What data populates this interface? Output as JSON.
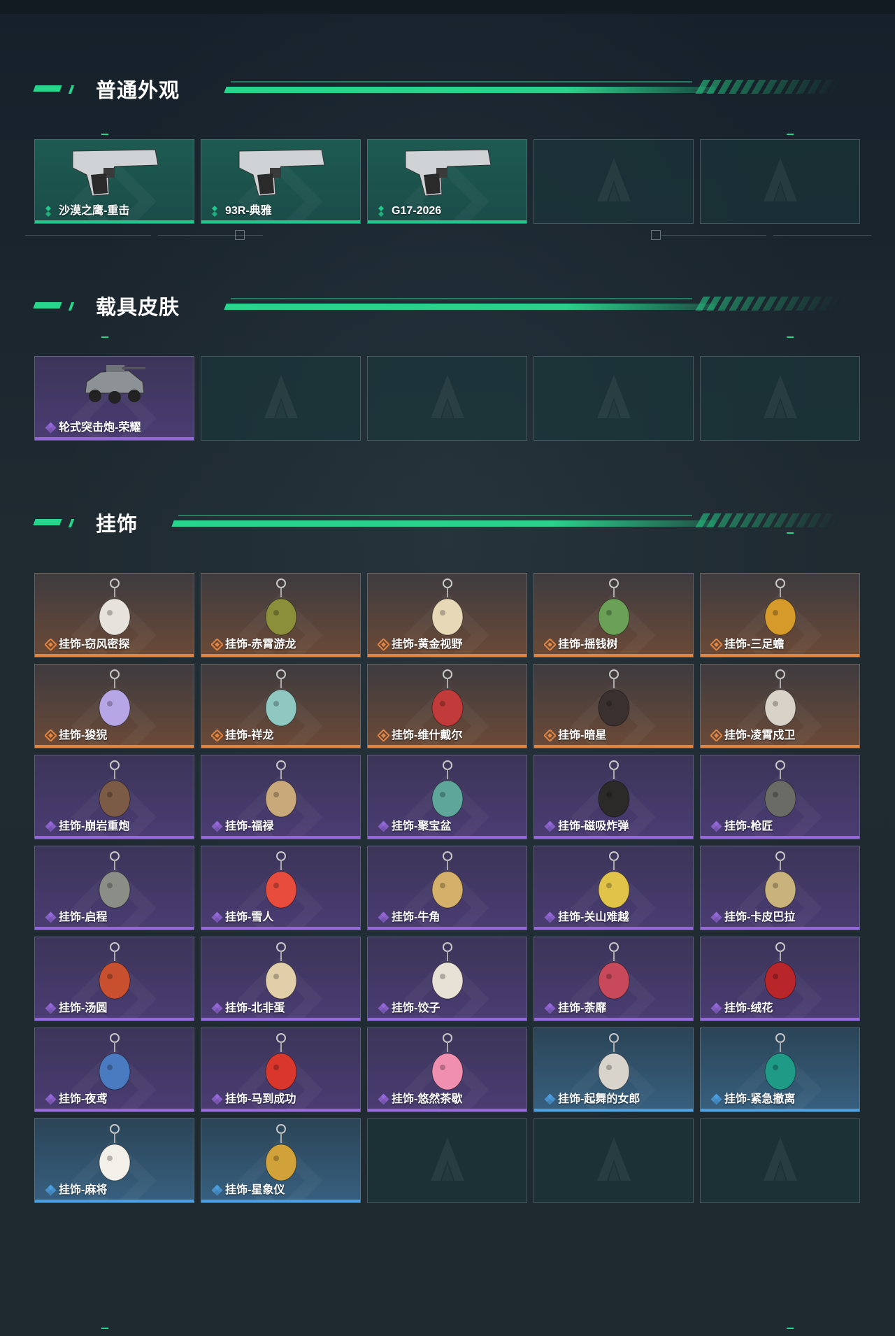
{
  "colors": {
    "accent": "#27d58b",
    "green_rarity": "#22c78a",
    "purple_rarity": "#9468d8",
    "orange_rarity": "#e08645",
    "blue_rarity": "#4b9fe0"
  },
  "sections": {
    "normal": {
      "title": "普通外观",
      "items": [
        {
          "name": "沙漠之鹰-重击",
          "rarity": "green",
          "icon": "pistol-icon"
        },
        {
          "name": "93R-典雅",
          "rarity": "green",
          "icon": "pistol-icon"
        },
        {
          "name": "G17-2026",
          "rarity": "green",
          "icon": "pistol-icon"
        }
      ]
    },
    "vehicle": {
      "title": "载具皮肤",
      "items": [
        {
          "name": "轮式突击炮-荣耀",
          "rarity": "purple",
          "icon": "armored-vehicle-icon"
        }
      ]
    },
    "charms": {
      "title": "挂饰",
      "items": [
        {
          "name": "挂饰-窃风密探",
          "rarity": "orange",
          "icon": "charm-icon"
        },
        {
          "name": "挂饰-赤霄游龙",
          "rarity": "orange",
          "icon": "charm-icon"
        },
        {
          "name": "挂饰-黄金视野",
          "rarity": "orange",
          "icon": "charm-icon"
        },
        {
          "name": "挂饰-摇钱树",
          "rarity": "orange",
          "icon": "charm-icon"
        },
        {
          "name": "挂饰-三足蟾",
          "rarity": "orange",
          "icon": "charm-icon"
        },
        {
          "name": "挂饰-狻猊",
          "rarity": "orange",
          "icon": "charm-icon"
        },
        {
          "name": "挂饰-祥龙",
          "rarity": "orange",
          "icon": "charm-icon"
        },
        {
          "name": "挂饰-维什戴尔",
          "rarity": "orange",
          "icon": "charm-icon"
        },
        {
          "name": "挂饰-暗星",
          "rarity": "orange",
          "icon": "charm-icon"
        },
        {
          "name": "挂饰-凌霄戍卫",
          "rarity": "orange",
          "icon": "charm-icon"
        },
        {
          "name": "挂饰-崩岩重炮",
          "rarity": "purple",
          "icon": "charm-icon"
        },
        {
          "name": "挂饰-福禄",
          "rarity": "purple",
          "icon": "charm-icon"
        },
        {
          "name": "挂饰-聚宝盆",
          "rarity": "purple",
          "icon": "charm-icon"
        },
        {
          "name": "挂饰-磁吸炸弹",
          "rarity": "purple",
          "icon": "charm-icon"
        },
        {
          "name": "挂饰-枪匠",
          "rarity": "purple",
          "icon": "charm-icon"
        },
        {
          "name": "挂饰-启程",
          "rarity": "purple",
          "icon": "charm-icon"
        },
        {
          "name": "挂饰-雪人",
          "rarity": "purple",
          "icon": "charm-icon"
        },
        {
          "name": "挂饰-牛角",
          "rarity": "purple",
          "icon": "charm-icon"
        },
        {
          "name": "挂饰-关山难越",
          "rarity": "purple",
          "icon": "charm-icon"
        },
        {
          "name": "挂饰-卡皮巴拉",
          "rarity": "purple",
          "icon": "charm-icon"
        },
        {
          "name": "挂饰-汤圆",
          "rarity": "purple",
          "icon": "charm-icon"
        },
        {
          "name": "挂饰-北非蛋",
          "rarity": "purple",
          "icon": "charm-icon"
        },
        {
          "name": "挂饰-饺子",
          "rarity": "purple",
          "icon": "charm-icon"
        },
        {
          "name": "挂饰-荼靡",
          "rarity": "purple",
          "icon": "charm-icon"
        },
        {
          "name": "挂饰-绒花",
          "rarity": "purple",
          "icon": "charm-icon"
        },
        {
          "name": "挂饰-夜鸢",
          "rarity": "purple",
          "icon": "charm-icon"
        },
        {
          "name": "挂饰-马到成功",
          "rarity": "purple",
          "icon": "charm-icon"
        },
        {
          "name": "挂饰-悠然茶歇",
          "rarity": "purple",
          "icon": "charm-icon"
        },
        {
          "name": "挂饰-起舞的女郎",
          "rarity": "blue",
          "icon": "charm-icon"
        },
        {
          "name": "挂饰-紧急撤离",
          "rarity": "blue",
          "icon": "charm-icon"
        },
        {
          "name": "挂饰-麻将",
          "rarity": "blue",
          "icon": "charm-icon"
        },
        {
          "name": "挂饰-星象仪",
          "rarity": "blue",
          "icon": "charm-icon"
        }
      ]
    }
  }
}
